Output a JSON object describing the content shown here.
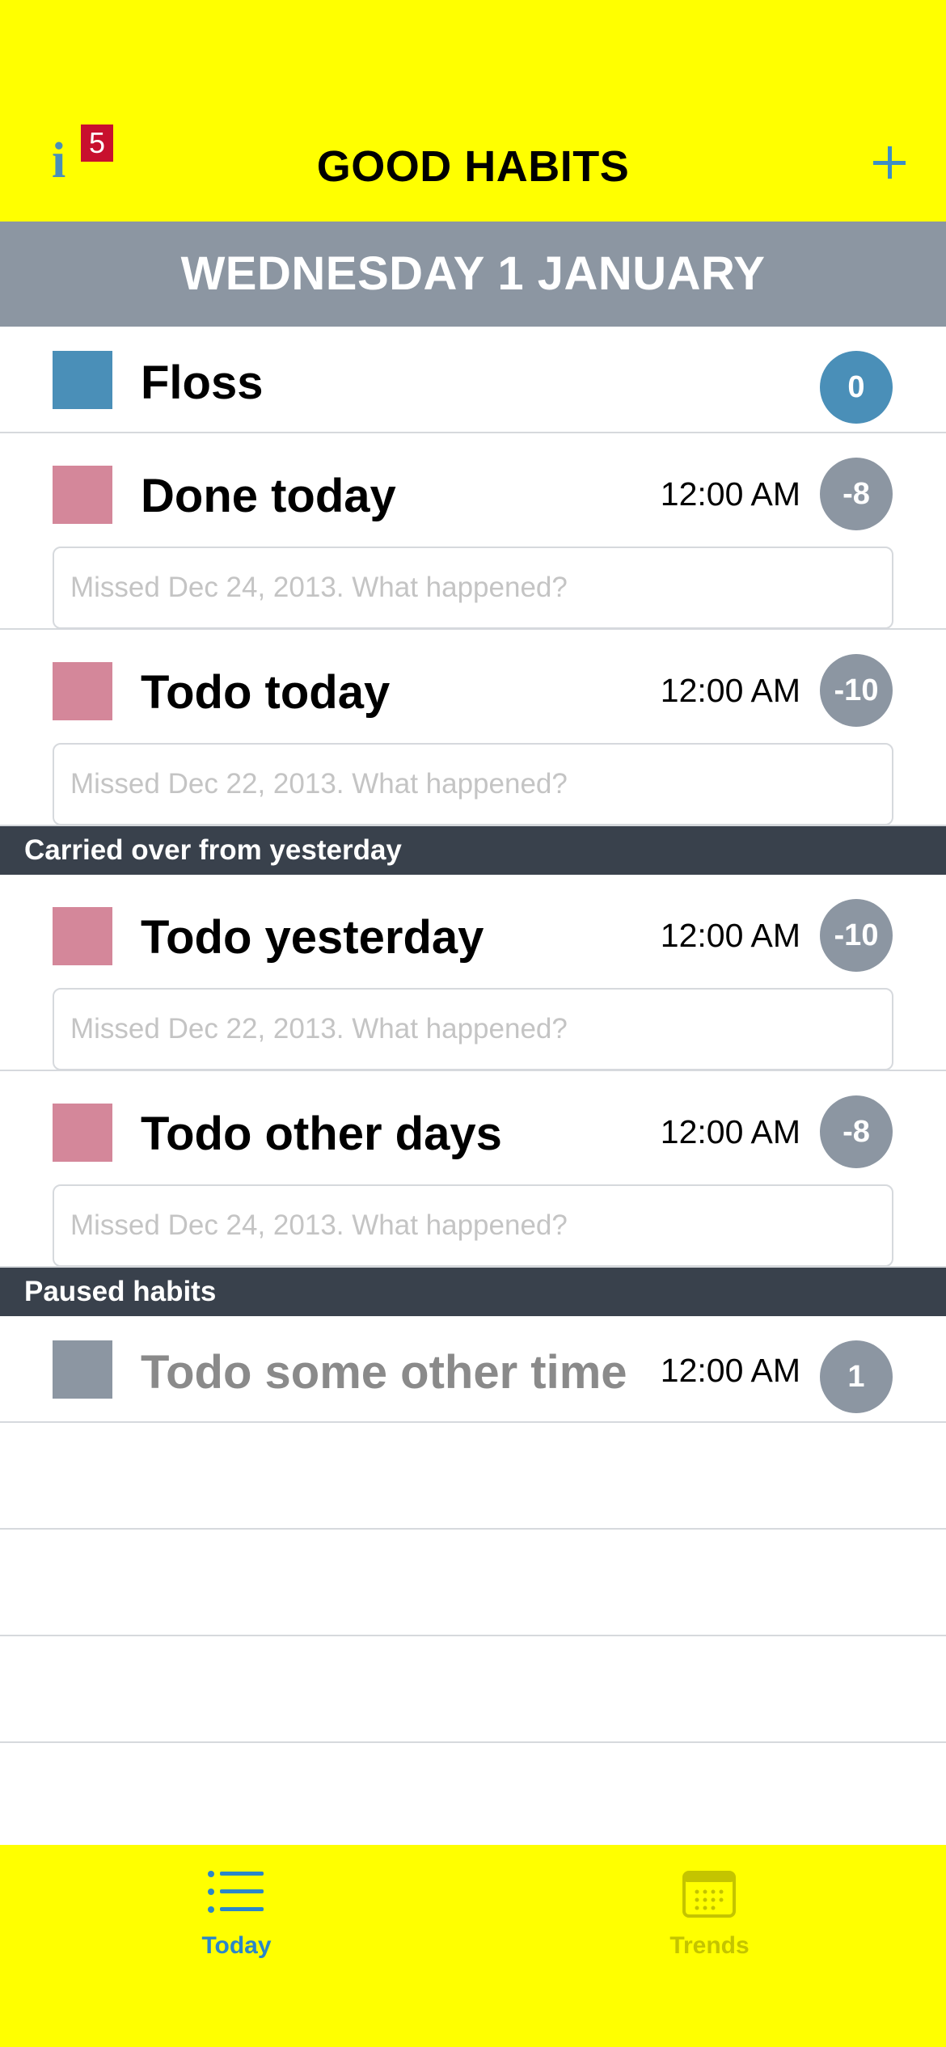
{
  "header": {
    "title": "GOOD HABITS",
    "info_icon": "info-icon",
    "info_badge": "5",
    "add_icon": "plus-icon",
    "accent_color": "#3d8ec4",
    "background_color": "#ffff00"
  },
  "date_bar": {
    "label": "WEDNESDAY 1 JANUARY"
  },
  "habits": [
    {
      "name": "Floss",
      "time": "",
      "score": "0",
      "swatch_color": "#4a8fb8",
      "score_color": "#4a8fb8"
    },
    {
      "name": "Done today",
      "time": "12:00 AM",
      "score": "-8",
      "swatch_color": "#d4879a",
      "score_color": "#8c96a2",
      "note_placeholder": "Missed Dec 24, 2013. What happened?"
    },
    {
      "name": "Todo today",
      "time": "12:00 AM",
      "score": "-10",
      "swatch_color": "#d4879a",
      "score_color": "#8c96a2",
      "note_placeholder": "Missed Dec 22, 2013. What happened?"
    }
  ],
  "sections": {
    "carried_over": "Carried over from yesterday",
    "paused": "Paused habits"
  },
  "carried_habits": [
    {
      "name": "Todo yesterday",
      "time": "12:00 AM",
      "score": "-10",
      "swatch_color": "#d4879a",
      "score_color": "#8c96a2",
      "note_placeholder": "Missed Dec 22, 2013. What happened?"
    },
    {
      "name": "Todo other days",
      "time": "12:00 AM",
      "score": "-8",
      "swatch_color": "#d4879a",
      "score_color": "#8c96a2",
      "note_placeholder": "Missed Dec 24, 2013. What happened?"
    }
  ],
  "paused_habits": [
    {
      "name": "Todo some other time",
      "time": "12:00 AM",
      "score": "1",
      "swatch_color": "#8c96a2",
      "score_color": "#8c96a2"
    }
  ],
  "tabbar": {
    "tabs": [
      {
        "label": "Today",
        "icon": "list-icon",
        "active": true,
        "color": "#2a86c8"
      },
      {
        "label": "Trends",
        "icon": "calendar-icon",
        "active": false,
        "color": "#c4c400"
      }
    ]
  }
}
